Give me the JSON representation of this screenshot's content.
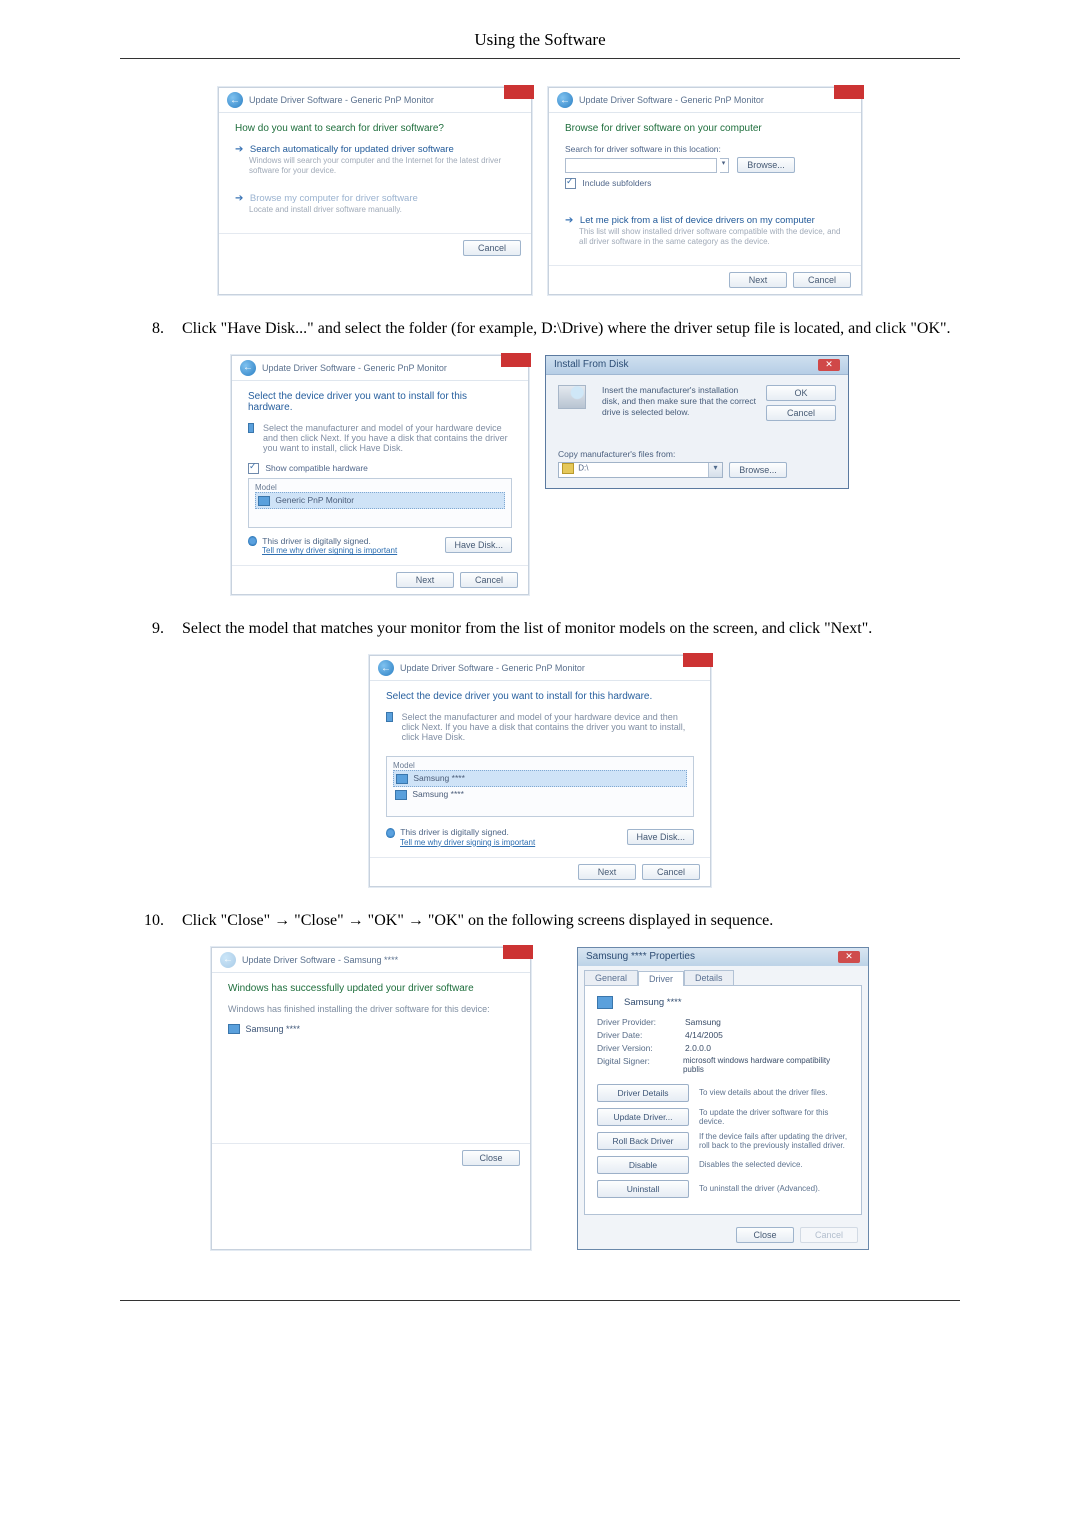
{
  "page": {
    "header": "Using the Software"
  },
  "shots_row1": {
    "left": {
      "breadcrumb": "Update Driver Software - Generic PnP Monitor",
      "heading": "How do you want to search for driver software?",
      "opt1_title": "Search automatically for updated driver software",
      "opt1_sub": "Windows will search your computer and the Internet for the latest driver software for your device.",
      "opt2_title": "Browse my computer for driver software",
      "opt2_sub": "Locate and install driver software manually.",
      "cancel": "Cancel"
    },
    "right": {
      "breadcrumb": "Update Driver Software - Generic PnP Monitor",
      "heading": "Browse for driver software on your computer",
      "search_label": "Search for driver software in this location:",
      "browse": "Browse...",
      "include": "Include subfolders",
      "opt_title": "Let me pick from a list of device drivers on my computer",
      "opt_sub": "This list will show installed driver software compatible with the device, and all driver software in the same category as the device.",
      "next": "Next",
      "cancel": "Cancel"
    }
  },
  "step8": {
    "num": "8.",
    "text": "Click \"Have Disk...\" and select the folder (for example, D:\\Drive) where the driver setup file is located, and click \"OK\"."
  },
  "shots_row2": {
    "left": {
      "breadcrumb": "Update Driver Software - Generic PnP Monitor",
      "heading": "Select the device driver you want to install for this hardware.",
      "sub": "Select the manufacturer and model of your hardware device and then click Next. If you have a disk that contains the driver you want to install, click Have Disk.",
      "show_compat": "Show compatible hardware",
      "model_hdr": "Model",
      "model_item": "Generic PnP Monitor",
      "signed": "This driver is digitally signed.",
      "tell_me": "Tell me why driver signing is important",
      "have_disk": "Have Disk...",
      "next": "Next",
      "cancel": "Cancel"
    },
    "right": {
      "title": "Install From Disk",
      "msg1": "Insert the manufacturer's installation disk, and then make sure that the correct drive is selected below.",
      "ok": "OK",
      "cancel": "Cancel",
      "copy_label": "Copy manufacturer's files from:",
      "path": "D:\\",
      "browse": "Browse..."
    }
  },
  "step9": {
    "num": "9.",
    "text": "Select the model that matches your monitor from the list of monitor models on the screen, and click \"Next\"."
  },
  "shots_row3": {
    "breadcrumb": "Update Driver Software - Generic PnP Monitor",
    "heading": "Select the device driver you want to install for this hardware.",
    "sub": "Select the manufacturer and model of your hardware device and then click Next. If you have a disk that contains the driver you want to install, click Have Disk.",
    "model_hdr": "Model",
    "model_item1": "Samsung ****",
    "model_item2": "Samsung ****",
    "signed": "This driver is digitally signed.",
    "tell_me": "Tell me why driver signing is important",
    "have_disk": "Have Disk...",
    "next": "Next",
    "cancel": "Cancel"
  },
  "step10": {
    "num": "10.",
    "text": "Click \"Close\" → \"Close\" → \"OK\" → \"OK\" on the following screens displayed in sequence."
  },
  "shots_row4": {
    "left": {
      "breadcrumb": "Update Driver Software - Samsung ****",
      "heading": "Windows has successfully updated your driver software",
      "sub": "Windows has finished installing the driver software for this device:",
      "device": "Samsung ****",
      "close": "Close"
    },
    "right": {
      "title": "Samsung **** Properties",
      "tabs": {
        "general": "General",
        "driver": "Driver",
        "details": "Details"
      },
      "device": "Samsung ****",
      "rows": {
        "provider_lbl": "Driver Provider:",
        "provider_val": "Samsung",
        "date_lbl": "Driver Date:",
        "date_val": "4/14/2005",
        "version_lbl": "Driver Version:",
        "version_val": "2.0.0.0",
        "signer_lbl": "Digital Signer:",
        "signer_val": "microsoft windows hardware compatibility publis"
      },
      "buttons": {
        "details": "Driver Details",
        "details_desc": "To view details about the driver files.",
        "update": "Update Driver...",
        "update_desc": "To update the driver software for this device.",
        "rollback": "Roll Back Driver",
        "rollback_desc": "If the device fails after updating the driver, roll back to the previously installed driver.",
        "disable": "Disable",
        "disable_desc": "Disables the selected device.",
        "uninstall": "Uninstall",
        "uninstall_desc": "To uninstall the driver (Advanced)."
      },
      "close": "Close",
      "cancel": "Cancel"
    }
  }
}
